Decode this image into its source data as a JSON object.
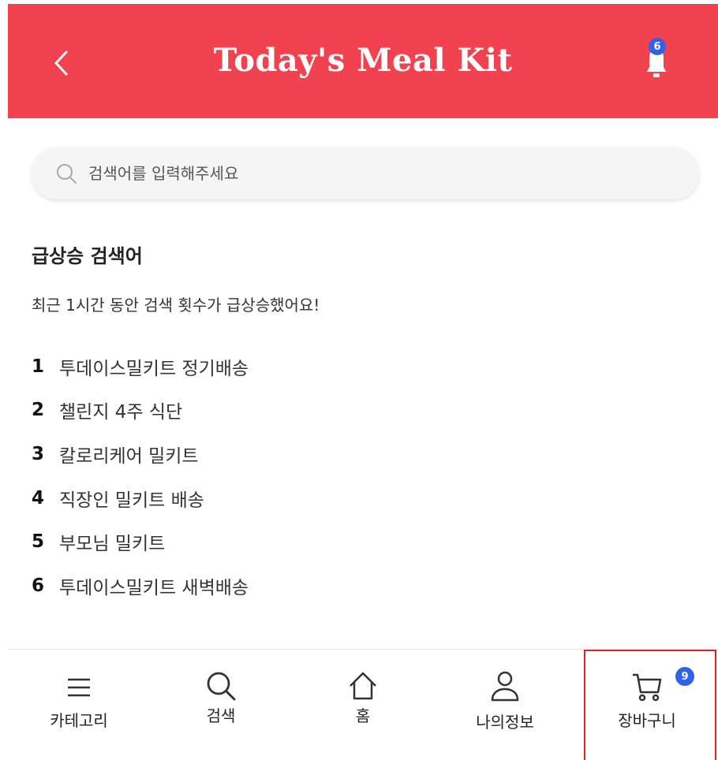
{
  "header": {
    "title": "Today's Meal Kit",
    "notification_count": "6",
    "background": "#f2424f"
  },
  "search": {
    "placeholder": "검색어를 입력해주세요"
  },
  "trending": {
    "title": "급상승 검색어",
    "description": "최근 1시간 동안 검색 횟수가 급상승했어요!",
    "items": [
      {
        "rank": "1",
        "keyword": "투데이스밀키트 정기배송"
      },
      {
        "rank": "2",
        "keyword": "챌린지 4주 식단"
      },
      {
        "rank": "3",
        "keyword": "칼로리케어 밀키트"
      },
      {
        "rank": "4",
        "keyword": "직장인 밀키트 배송"
      },
      {
        "rank": "5",
        "keyword": "부모님 밀키트"
      },
      {
        "rank": "6",
        "keyword": "투데이스밀키트 새벽배송"
      }
    ]
  },
  "bottom_nav": {
    "items": [
      {
        "label": "카테고리",
        "icon": "menu-icon"
      },
      {
        "label": "검색",
        "icon": "search-icon"
      },
      {
        "label": "홈",
        "icon": "home-icon"
      },
      {
        "label": "나의정보",
        "icon": "user-icon"
      },
      {
        "label": "장바구니",
        "icon": "cart-icon"
      }
    ],
    "cart_count": "9",
    "badge_color": "#2f62e8"
  }
}
